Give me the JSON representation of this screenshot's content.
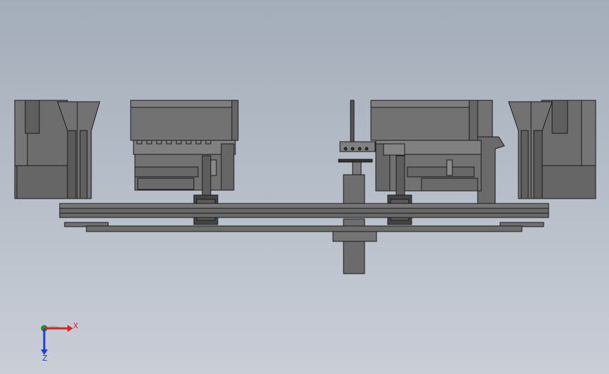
{
  "triad": {
    "x_label": "X",
    "z_label": "Z",
    "x_color": "#e02020",
    "y_color": "#20b020",
    "z_color": "#2040d0"
  },
  "colors": {
    "body": "#6f6f6f",
    "body_light": "#8a8a8a",
    "body_dark": "#4e4e4e",
    "outline": "#1a1a1a"
  }
}
